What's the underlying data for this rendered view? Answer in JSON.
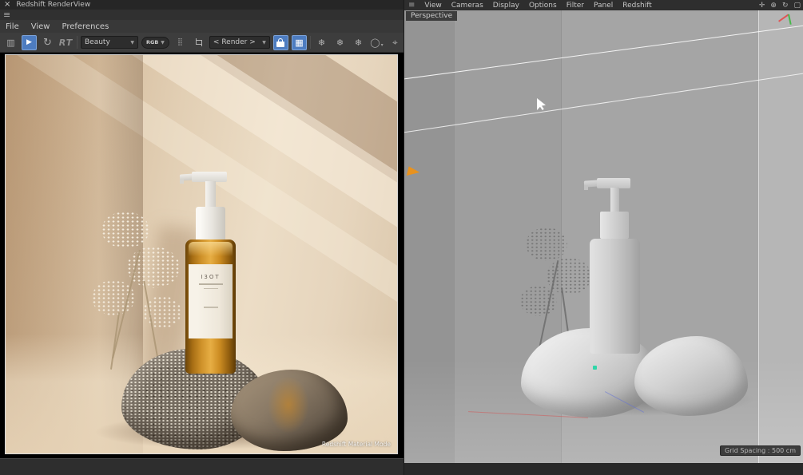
{
  "renderview": {
    "title": "Redshift RenderView",
    "menus": [
      "File",
      "View",
      "Preferences"
    ],
    "toolbar": {
      "rt_label": "RT",
      "aov_value": "Beauty",
      "rgb_label": "RGB",
      "bucket_value": "< Render >"
    },
    "overlay_status": "Redshift Material Mode",
    "bottle_brand": "I3OT"
  },
  "viewport": {
    "menus": [
      "View",
      "Cameras",
      "Display",
      "Options",
      "Filter",
      "Panel",
      "Redshift"
    ],
    "view_label": "Perspective",
    "grid_spacing": "Grid Spacing : 500 cm"
  },
  "icons": {
    "close": "×",
    "hamburger": "≡",
    "snapshot": "▥",
    "play": "▶",
    "restart": "↻",
    "dropdown": "▼",
    "dither": "⣿",
    "grid": "▦",
    "snowflake": "❄",
    "region": "◯",
    "region_arrow": "▾",
    "focus": "⌖",
    "pan": "✛",
    "zoom": "⊕",
    "rotate": "↻",
    "maximize": "▢"
  },
  "colors": {
    "accent_blue": "#4d7cc0",
    "amber": "#cf922a",
    "green_dot": "#2fd6a8",
    "orange_marker": "#e8921e"
  }
}
